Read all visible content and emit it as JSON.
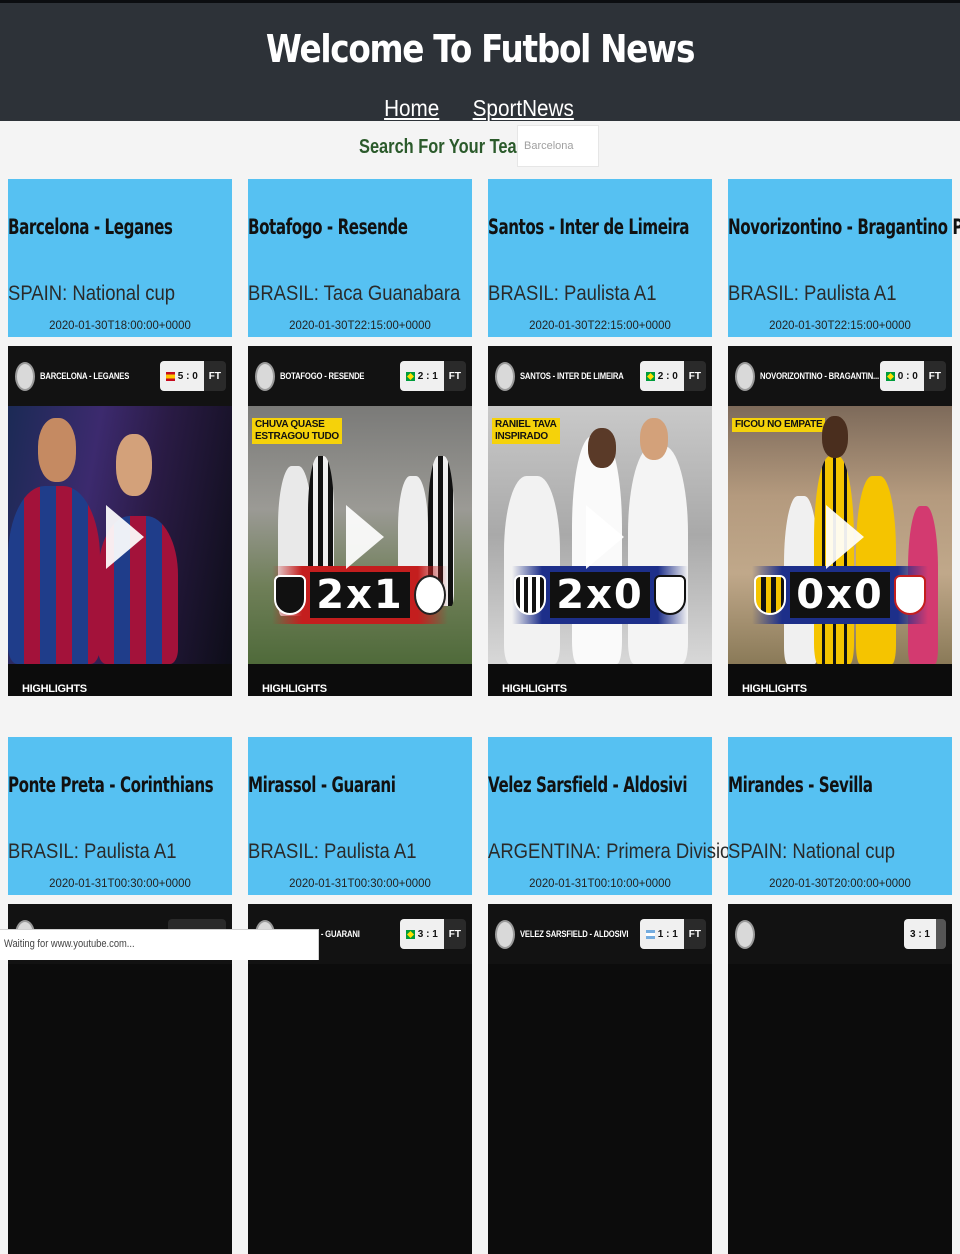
{
  "header": {
    "title": "Welcome To Futbol News",
    "nav": [
      "Home",
      "SportNews"
    ]
  },
  "search": {
    "label": "Search For Your Team:",
    "placeholder": "Barcelona"
  },
  "matches": [
    {
      "teams": "Barcelona - Leganes",
      "league": "SPAIN: National cup",
      "date": "2020-01-30T18:00:00+0000",
      "video_title": "BARCELONA - LEGANES",
      "score": "5 : 0",
      "status": "FT",
      "flag": "spain-flag",
      "caption": "",
      "footer": "HIGHLIGHTS"
    },
    {
      "teams": "Botafogo - Resende",
      "league": "BRASIL: Taca Guanabara",
      "date": "2020-01-30T22:15:00+0000",
      "video_title": "BOTAFOGO - RESENDE",
      "score": "2 : 1",
      "status": "FT",
      "flag": "brazil-flag",
      "caption": "CHUVA QUASE\nESTRAGOU TUDO",
      "big_score": "2x1",
      "footer": "HIGHLIGHTS"
    },
    {
      "teams": "Santos - Inter de Limeira",
      "league": "BRASIL: Paulista A1",
      "date": "2020-01-30T22:15:00+0000",
      "video_title": "SANTOS - INTER DE LIMEIRA",
      "score": "2 : 0",
      "status": "FT",
      "flag": "brazil-flag",
      "caption": "RANIEL TAVA\nINSPIRADO",
      "big_score": "2x0",
      "footer": "HIGHLIGHTS"
    },
    {
      "teams": "Novorizontino - Bragantino PA",
      "league": "BRASIL: Paulista A1",
      "date": "2020-01-30T22:15:00+0000",
      "video_title": "NOVORIZONTINO - BRAGANTIN...",
      "score": "0 : 0",
      "status": "FT",
      "flag": "brazil-flag",
      "caption": "FICOU NO EMPATE",
      "big_score": "0x0",
      "footer": "HIGHLIGHTS"
    },
    {
      "teams": "Ponte Preta - Corinthians",
      "league": "BRASIL: Paulista A1",
      "date": "2020-01-31T00:30:00+0000"
    },
    {
      "teams": "Mirassol - Guarani",
      "league": "BRASIL: Paulista A1",
      "date": "2020-01-31T00:30:00+0000",
      "video_title": "MIRASSOL - GUARANI",
      "score": "3 : 1",
      "status": "FT",
      "flag": "brazil-flag"
    },
    {
      "teams": "Velez Sarsfield - Aldosivi",
      "league": "ARGENTINA: Primera Division",
      "date": "2020-01-31T00:10:00+0000",
      "video_title": "VELEZ SARSFIELD - ALDOSIVI",
      "score": "1 : 1",
      "status": "FT",
      "flag": "argentina-flag"
    },
    {
      "teams": "Mirandes - Sevilla",
      "league": "SPAIN: National cup",
      "date": "2020-01-30T20:00:00+0000",
      "score": "3 : 1"
    }
  ],
  "status_bar": "Waiting for www.youtube.com...",
  "colors": {
    "header_bg": "#2d3238",
    "card_bg": "#56c1f2",
    "page_bg": "#f4f4f4",
    "search_label": "#2b5a2b"
  }
}
